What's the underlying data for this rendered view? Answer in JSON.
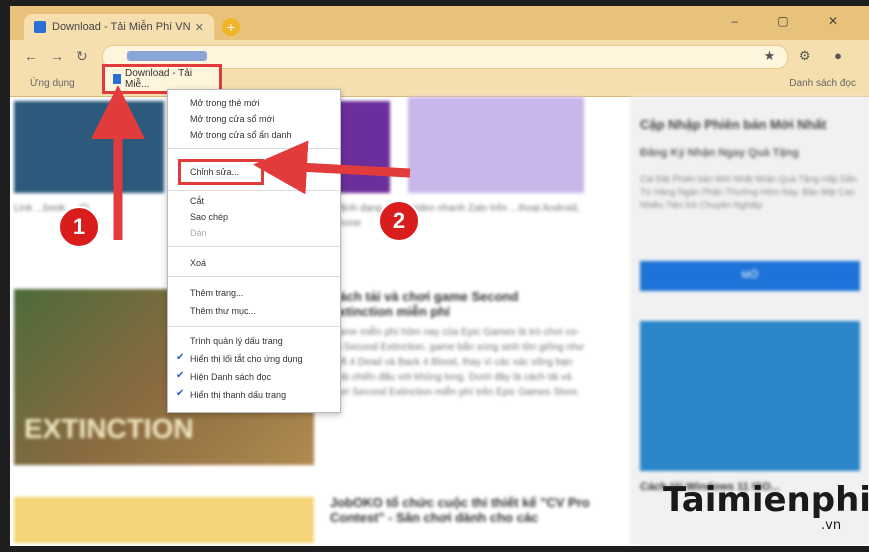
{
  "browser": {
    "tab_title": "Download - Tải Miễn Phí VN",
    "tab_close": "✕",
    "new_tab": "+",
    "window_controls": "– ▢ ✕",
    "nav": {
      "back": "←",
      "forward": "→",
      "reload": "↻"
    },
    "toolbar_right": "★ ⚙ ●"
  },
  "bookmarks_bar": {
    "apps_label": "Ứng dụng",
    "highlighted_item": "Download - Tải Miễ...",
    "right_label": "Danh sách đọc"
  },
  "context_menu": {
    "items": [
      {
        "label": "Mở trong thẻ mới",
        "enabled": true
      },
      {
        "label": "Mở trong cửa sổ mới",
        "enabled": true
      },
      {
        "label": "Mở trong cửa sổ ẩn danh",
        "enabled": true
      },
      {
        "label": "Chỉnh sửa...",
        "enabled": true,
        "highlighted": true
      },
      {
        "label": "Cắt",
        "enabled": true
      },
      {
        "label": "Sao chép",
        "enabled": true
      },
      {
        "label": "Dán",
        "enabled": false
      },
      {
        "label": "Xoá",
        "enabled": true
      },
      {
        "label": "Thêm trang...",
        "enabled": true
      },
      {
        "label": "Thêm thư mục...",
        "enabled": true
      },
      {
        "label": "Trình quản lý dấu trang",
        "enabled": true
      },
      {
        "label": "Hiển thị lối tắt cho ứng dụng",
        "enabled": true,
        "checked": true
      },
      {
        "label": "Hiện Danh sách đọc",
        "enabled": true,
        "checked": true
      },
      {
        "label": "Hiển thị thanh dấu trang",
        "enabled": true,
        "checked": true
      }
    ]
  },
  "page": {
    "left_caption": "Link ...book ... ID",
    "article1_title": "Cách tải và chơi game Second Extinction miễn phí",
    "article1_text": "Game miễn phí hôm nay của Epic Games là trò chơi co-op Second Extinction, game bắn súng sinh tồn giống như Left 4 Dead và Back 4 Blood, thay vì các xác sống bạn phải chiến đấu với khủng long. Dưới đây là cách tải và chơi Second Extinction miễn phí trên Epic Games Store.",
    "article0_text": "...định dạng ...gửi video nhanh Zalo trên ...thoại Android, iPhone",
    "article2_title": "JobOKO tổ chức cuộc thi thiết kế \"CV Pro Contest\" - Sân chơi dành cho các",
    "game_title": "EXTINCTION",
    "sidebar_title": "Cập Nhập Phiên bản Mới Nhất",
    "sidebar_sub": "Đăng Ký Nhận Ngay Quà Tặng",
    "sidebar_small": "Cài Đặt Phiên bản Mới Nhất Nhận Quà Tặng Hấp Dẫn Từ Hàng Ngàn Phần Thưởng Hôm Nay. Bảo Mật Cao Nhiều Tiện Ích Chuyên Nghiệp",
    "sidebar_button": "MỞ",
    "sidebar_caption": "Cách tải Windows 11 ISO..."
  },
  "annotations": {
    "step1": "1",
    "step2": "2"
  },
  "watermark": {
    "brand": "Taimienphi",
    "suffix": ".vn"
  },
  "colors": {
    "accent_red": "#e23b3b",
    "badge_red": "#d91d1d",
    "chrome_orange": "#e8c27a"
  }
}
